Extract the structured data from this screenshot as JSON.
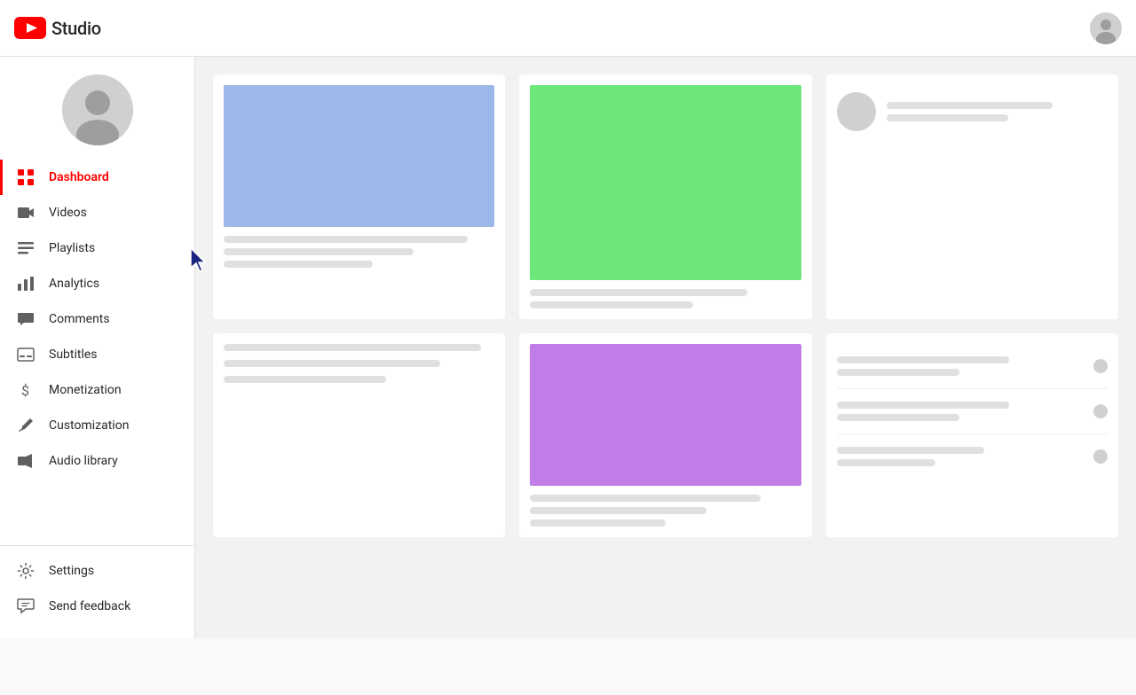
{
  "header": {
    "logo_text": "Studio",
    "user_avatar_label": "User avatar"
  },
  "sidebar": {
    "nav_items": [
      {
        "id": "dashboard",
        "label": "Dashboard",
        "icon": "grid",
        "active": true
      },
      {
        "id": "videos",
        "label": "Videos",
        "icon": "video",
        "active": false
      },
      {
        "id": "playlists",
        "label": "Playlists",
        "icon": "list",
        "active": false
      },
      {
        "id": "analytics",
        "label": "Analytics",
        "icon": "bar-chart",
        "active": false
      },
      {
        "id": "comments",
        "label": "Comments",
        "icon": "comment",
        "active": false
      },
      {
        "id": "subtitles",
        "label": "Subtitles",
        "icon": "subtitles",
        "active": false
      },
      {
        "id": "monetization",
        "label": "Monetization",
        "icon": "dollar",
        "active": false
      },
      {
        "id": "customization",
        "label": "Customization",
        "icon": "brush",
        "active": false
      },
      {
        "id": "audio-library",
        "label": "Audio library",
        "icon": "audio",
        "active": false
      }
    ],
    "bottom_items": [
      {
        "id": "settings",
        "label": "Settings",
        "icon": "gear"
      },
      {
        "id": "send-feedback",
        "label": "Send feedback",
        "icon": "feedback"
      }
    ]
  },
  "main": {
    "cards": [
      {
        "id": "card-1",
        "has_thumb": true,
        "thumb_color": "blue"
      },
      {
        "id": "card-2",
        "has_thumb": true,
        "thumb_color": "green"
      },
      {
        "id": "card-3",
        "has_thumb": false,
        "has_profile": true
      },
      {
        "id": "card-4",
        "has_thumb": false,
        "is_text_only": true
      },
      {
        "id": "card-5",
        "has_thumb": true,
        "thumb_color": "purple"
      },
      {
        "id": "card-6",
        "has_thumb": false,
        "is_list": true
      }
    ]
  }
}
